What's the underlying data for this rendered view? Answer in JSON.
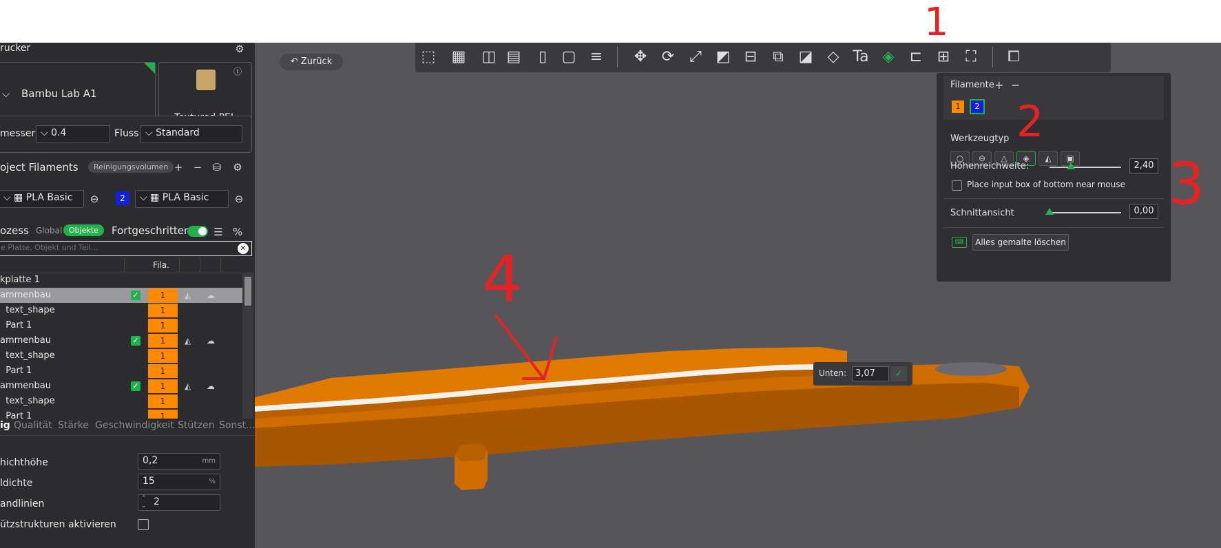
{
  "printer": {
    "section_title": "rucker",
    "name": "Bambu Lab A1",
    "plate": "Textured PEI ...",
    "nozzle_label": "messer",
    "nozzle_value": "0.4",
    "flow_label": "Fluss",
    "flow_value": "Standard"
  },
  "filaments": {
    "title": "oject Filaments",
    "purge_button": "Reinigungsvolumen",
    "slot1_name": "PLA Basic",
    "slot2_num": "2",
    "slot2_name": "PLA Basic"
  },
  "process": {
    "title": "ozess",
    "global": "Global",
    "objects": "Objekte",
    "advanced": "Fortgeschritten",
    "search_placeholder": "e Platte, Objekt und Teil..."
  },
  "tree": {
    "col_fila": "Fila.",
    "rows": [
      {
        "label": "kplatte 1",
        "fila": ""
      },
      {
        "label": "ammenbau",
        "fila": "1"
      },
      {
        "label": "  text_shape",
        "fila": "1"
      },
      {
        "label": "  Part 1",
        "fila": "1"
      },
      {
        "label": "ammenbau",
        "fila": "1"
      },
      {
        "label": "  text_shape",
        "fila": "1"
      },
      {
        "label": "  Part 1",
        "fila": "1"
      },
      {
        "label": "ammenbau",
        "fila": "1"
      },
      {
        "label": "  text_shape",
        "fila": "1"
      },
      {
        "label": "  Part 1",
        "fila": "1"
      }
    ]
  },
  "tabs": [
    "ig",
    "Qualität",
    "Stärke",
    "Geschwindigkeit",
    "Stützen",
    "Sonst..."
  ],
  "settings": {
    "layer_label": "hichthöhe",
    "layer_value": "0,2",
    "layer_unit": "mm",
    "infill_label": "ldichte",
    "infill_value": "15",
    "infill_unit": "%",
    "walls_label": "andlinien",
    "walls_value": "2",
    "support_label": "ützstrukturen aktivieren"
  },
  "viewport": {
    "back_button": "Zurück"
  },
  "paint_panel": {
    "filaments_title": "Filamente",
    "add": "+",
    "remove": "−",
    "fil1": "1",
    "fil2": "2",
    "tooltype_label": "Werkzeugtyp",
    "height_label": "Höhenreichweite:",
    "height_value": "2,40",
    "height_fraction": 0.3,
    "checkbox_label": "Place input box of bottom near mouse",
    "section_label": "Schnittansicht",
    "section_value": "0,00",
    "section_fraction": 0.0,
    "clear_button": "Alles gemalte löschen"
  },
  "bottom_box": {
    "label": "Unten:",
    "value": "3,07"
  },
  "annotations": [
    "1",
    "2",
    "3",
    "4"
  ],
  "colors": {
    "accent_green": "#22b24c",
    "filament_orange": "#ff8a00",
    "filament_blue": "#1420d8",
    "annotation_red": "#e22424"
  }
}
